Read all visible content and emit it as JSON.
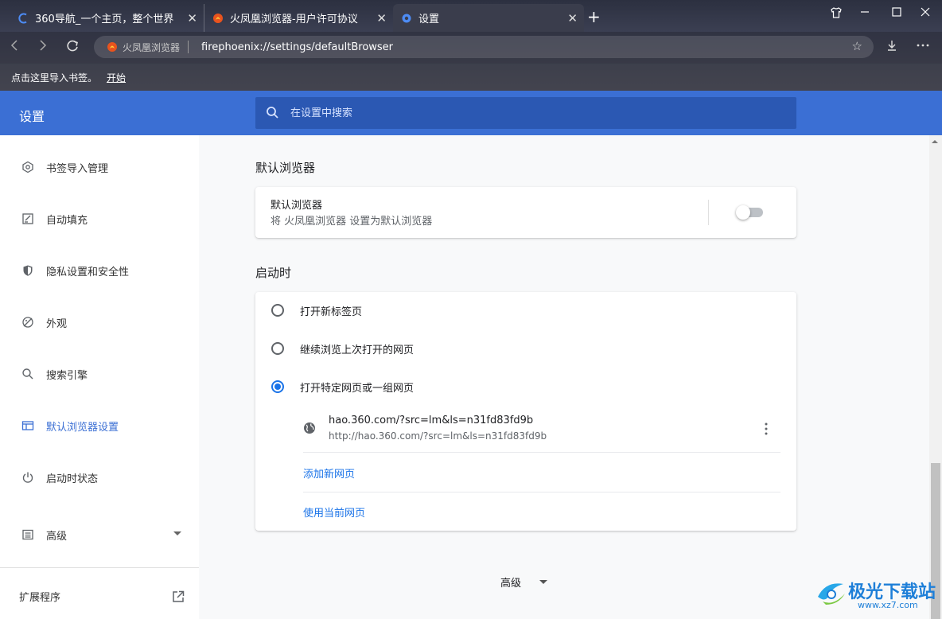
{
  "tabs": [
    {
      "title": "360导航_一个主页，整个世界",
      "icon": "360-loading-icon"
    },
    {
      "title": "火凤凰浏览器-用户许可协议",
      "icon": "firephoenix-icon"
    },
    {
      "title": "设置",
      "icon": "settings-gear-icon"
    }
  ],
  "address": {
    "site_label": "火凤凰浏览器",
    "url": "firephoenix://settings/defaultBrowser"
  },
  "bookmarks_bar": {
    "prompt": "点击这里导入书签。",
    "start_link": "开始"
  },
  "settings": {
    "title": "设置",
    "search_placeholder": "在设置中搜索"
  },
  "sidebar": {
    "items": [
      {
        "label": "书签导入管理",
        "icon": "bookmark-gear-icon"
      },
      {
        "label": "自动填充",
        "icon": "edit-form-icon"
      },
      {
        "label": "隐私设置和安全性",
        "icon": "shield-icon"
      },
      {
        "label": "外观",
        "icon": "palette-icon"
      },
      {
        "label": "搜索引擎",
        "icon": "search-icon"
      },
      {
        "label": "默认浏览器设置",
        "icon": "browser-window-icon"
      },
      {
        "label": "启动时状态",
        "icon": "power-icon"
      },
      {
        "label": "高级",
        "icon": "list-icon"
      }
    ],
    "active_index": 5,
    "extensions_label": "扩展程序"
  },
  "default_browser": {
    "section_title": "默认浏览器",
    "card_title": "默认浏览器",
    "card_subtitle": "将 火凤凰浏览器 设置为默认浏览器",
    "toggle_on": false
  },
  "startup": {
    "section_title": "启动时",
    "options": [
      {
        "label": "打开新标签页",
        "checked": false
      },
      {
        "label": "继续浏览上次打开的网页",
        "checked": false
      },
      {
        "label": "打开特定网页或一组网页",
        "checked": true
      }
    ],
    "pages": [
      {
        "name": "hao.360.com/?src=lm&ls=n31fd83fd9b",
        "url": "http://hao.360.com/?src=lm&ls=n31fd83fd9b"
      }
    ],
    "add_page": "添加新网页",
    "use_current": "使用当前网页"
  },
  "advanced_label": "高级",
  "watermark": {
    "text": "极光下载站",
    "sub": "www.xz7.com"
  },
  "colors": {
    "accent": "#3b6fd4",
    "link": "#1a73e8"
  }
}
